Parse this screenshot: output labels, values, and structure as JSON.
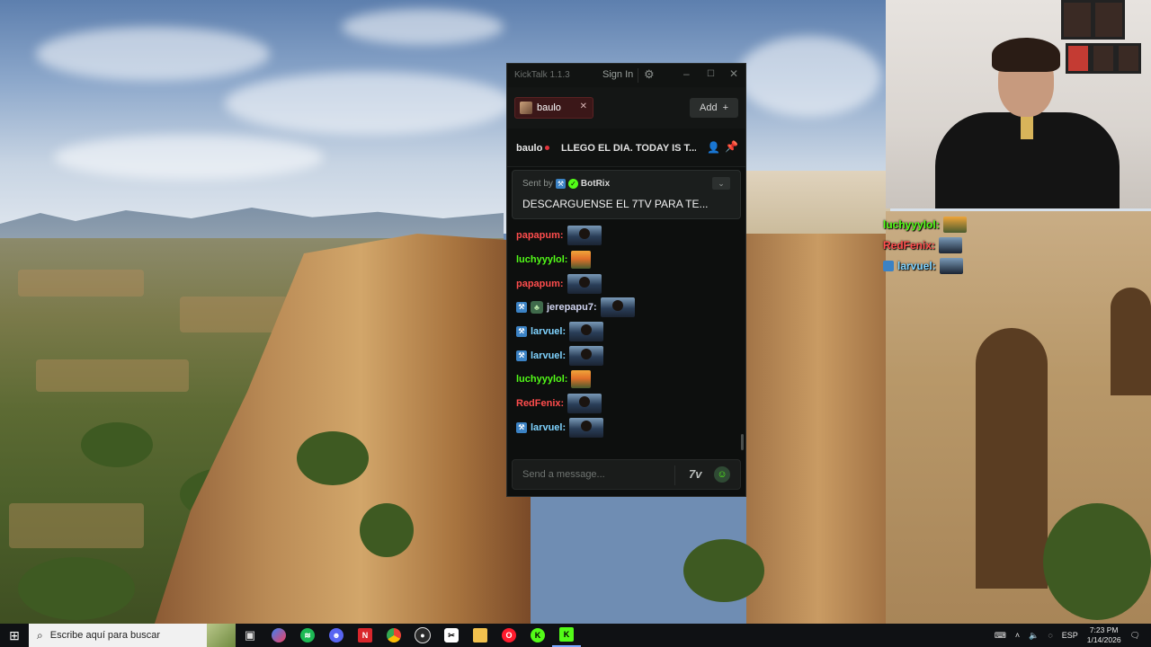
{
  "window": {
    "title": "KickTalk 1.1.3",
    "signin_label": "Sign In"
  },
  "tabs": [
    {
      "name": "baulo",
      "active": true
    }
  ],
  "add_label": "Add",
  "stream": {
    "streamer": "baulo",
    "title": "LLEGO EL DIA. TODAY IS T..."
  },
  "pinned": {
    "sent_by": "Sent by",
    "bot_name": "BotRix",
    "message": "DESCARGUENSE EL 7TV PARA TE..."
  },
  "chat": [
    {
      "user": "papapum:",
      "color": "#ff4d4d",
      "emote": "face",
      "badges": []
    },
    {
      "user": "luchyyylol:",
      "color": "#53fc18",
      "emote": "sunset",
      "badges": []
    },
    {
      "user": "papapum:",
      "color": "#ff4d4d",
      "emote": "face",
      "badges": []
    },
    {
      "user": "jerepapu7:",
      "color": "#d0d4f0",
      "emote": "face",
      "badges": [
        "bot",
        "sub"
      ]
    },
    {
      "user": "larvuel:",
      "color": "#7fd3ff",
      "emote": "face",
      "badges": [
        "bot"
      ]
    },
    {
      "user": "larvuel:",
      "color": "#7fd3ff",
      "emote": "face",
      "badges": [
        "bot"
      ]
    },
    {
      "user": "luchyyylol:",
      "color": "#53fc18",
      "emote": "sunset",
      "badges": []
    },
    {
      "user": "RedFenix:",
      "color": "#ff4d4d",
      "emote": "face",
      "badges": []
    },
    {
      "user": "larvuel:",
      "color": "#7fd3ff",
      "emote": "face",
      "badges": [
        "bot"
      ]
    }
  ],
  "input": {
    "placeholder": "Send a message...",
    "emote_7tv": "7v"
  },
  "webcam_chat": [
    {
      "user": "luchyyylol:",
      "color": "#53fc18"
    },
    {
      "user": "RedFenix:",
      "color": "#ff4d4d"
    },
    {
      "user": "larvuel:",
      "color": "#7fd3ff"
    }
  ],
  "taskbar": {
    "search_placeholder": "Escribe aquí para buscar",
    "language": "ESP",
    "time": "7:23 PM",
    "date": "1/14/2026",
    "apps": [
      "task-view-icon",
      "copilot-icon",
      "spotify-icon",
      "discord-icon",
      "news-app-icon",
      "chrome-icon",
      "obs-icon",
      "capcut-icon",
      "file-explorer-icon",
      "opera-icon",
      "kick-icon",
      "kicktalk-icon"
    ]
  },
  "colors": {
    "kick_green": "#53fc18",
    "tab_red": "#3b1718",
    "window_bg": "#0d0f0e"
  }
}
